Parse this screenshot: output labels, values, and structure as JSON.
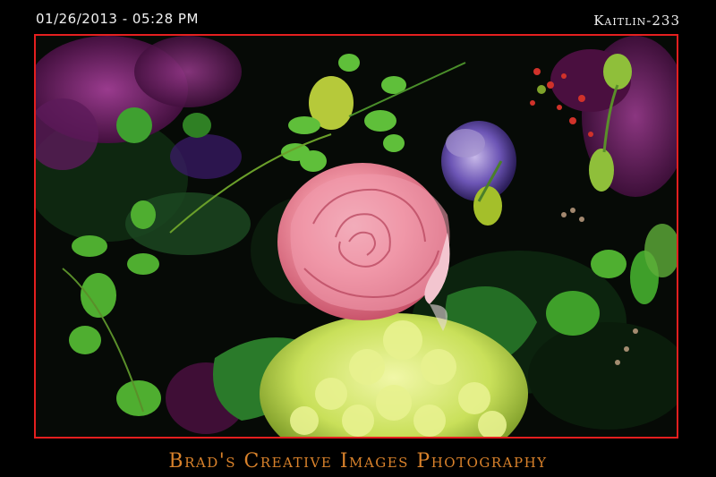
{
  "header": {
    "timestamp": "01/26/2013 - 05:28 PM",
    "photo_id": "Kaitlin-233"
  },
  "footer": {
    "studio_name": "Brad's Creative Images Photography"
  },
  "colors": {
    "border": "#e41f1f",
    "caption": "#d9822b",
    "header_text": "#f2f2f2"
  }
}
